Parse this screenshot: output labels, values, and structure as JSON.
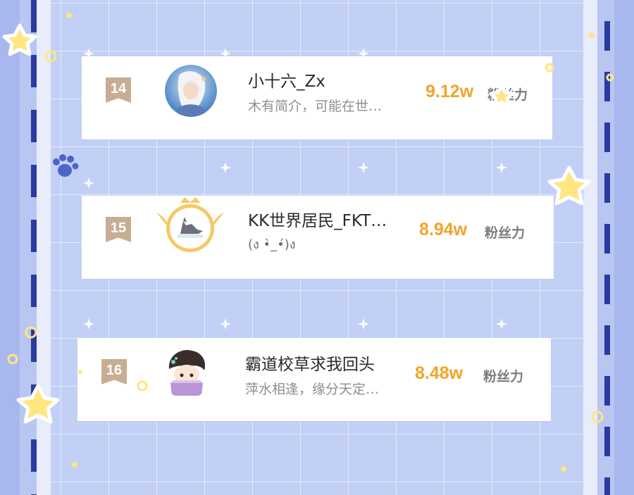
{
  "colors": {
    "background": "#c2d0f5",
    "rail_dash": "#2a3aa0",
    "rank_badge": "#c7ad93",
    "fans_number": "#f2a42a",
    "star": "#ffe680"
  },
  "ranking": {
    "items": [
      {
        "rank": "14",
        "name": "小十六_Zx",
        "bio": "木有简介，可能在世…",
        "fans": "9.12w",
        "fans_label": "粉丝力",
        "avatar_icon": "avatar-white-hair-character"
      },
      {
        "rank": "15",
        "name": "KK世界居民_FKT…",
        "bio": "(ง •̀_•́)ง",
        "fans": "8.94w",
        "fans_label": "粉丝力",
        "avatar_icon": "avatar-wolf-crown-badge"
      },
      {
        "rank": "16",
        "name": "霸道校草求我回头",
        "bio": "萍水相逢，缘分天定…",
        "fans": "8.48w",
        "fans_label": "粉丝力",
        "avatar_icon": "avatar-chibi-character-box"
      }
    ]
  }
}
